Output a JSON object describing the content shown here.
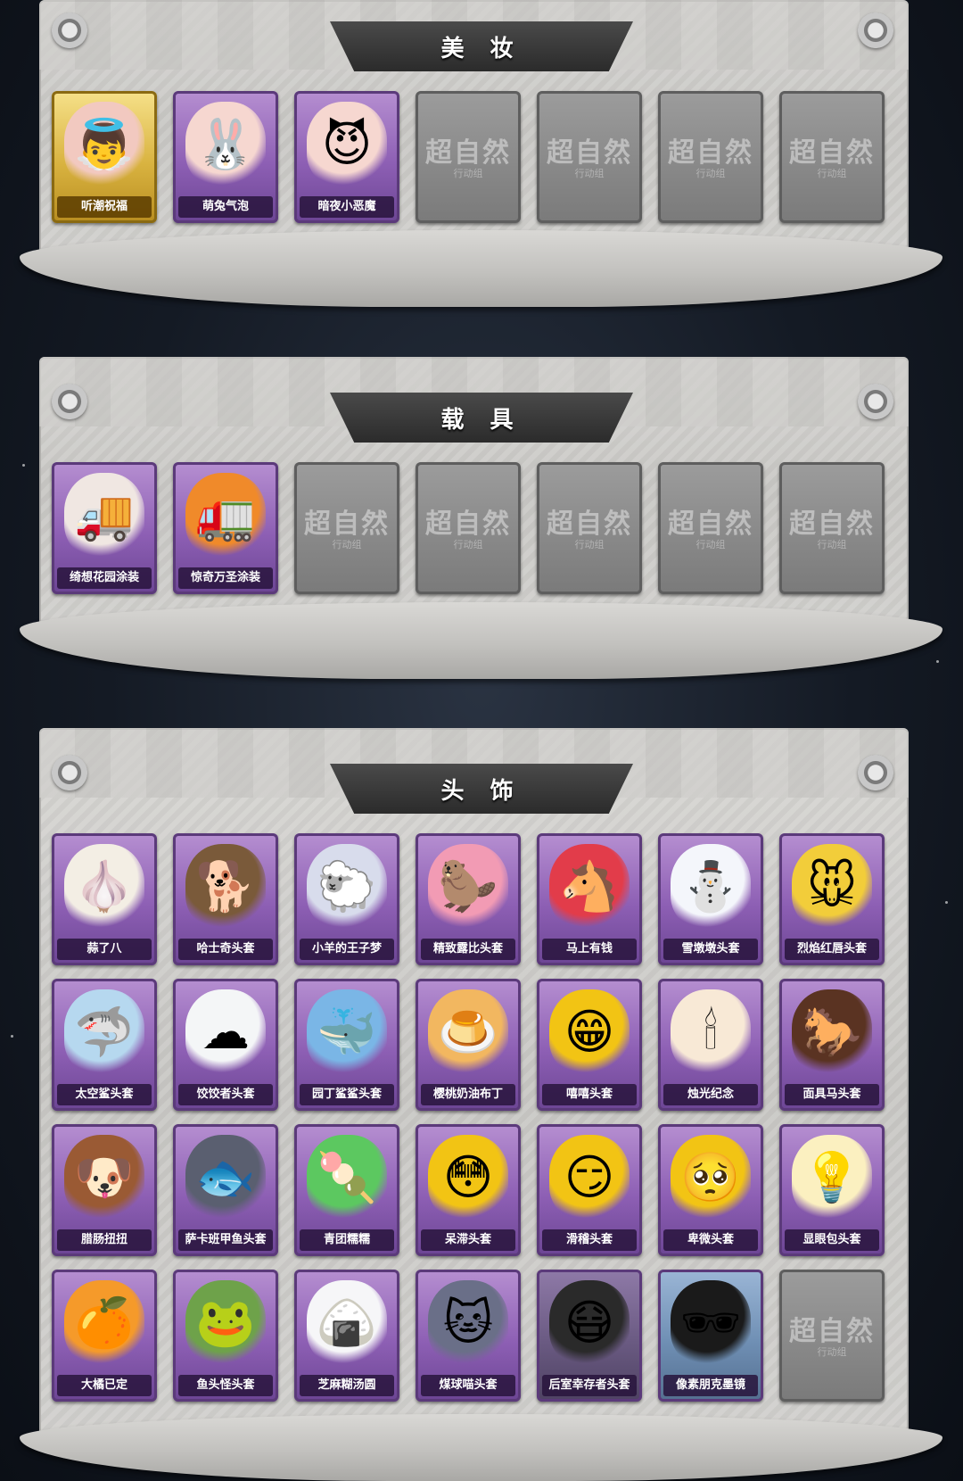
{
  "sections": [
    {
      "title": "美 妆",
      "cards": [
        {
          "label": "听潮祝福",
          "rarity": "gold",
          "icon": "face-with-wings-icon",
          "glyph": "👼",
          "color": "#f2c9c0"
        },
        {
          "label": "萌兔气泡",
          "rarity": "purple",
          "icon": "bunny-face-icon",
          "glyph": "🐰",
          "color": "#f6d7d0"
        },
        {
          "label": "暗夜小恶魔",
          "rarity": "purple",
          "icon": "devil-face-icon",
          "glyph": "😈",
          "color": "#f6d7d0"
        },
        {
          "label": "",
          "rarity": "empty",
          "watermark": "超自然",
          "sub": "行动组"
        },
        {
          "label": "",
          "rarity": "empty",
          "watermark": "超自然",
          "sub": "行动组"
        },
        {
          "label": "",
          "rarity": "empty",
          "watermark": "超自然",
          "sub": "行动组"
        },
        {
          "label": "",
          "rarity": "empty",
          "watermark": "超自然",
          "sub": "行动组"
        }
      ]
    },
    {
      "title": "载 具",
      "cards": [
        {
          "label": "绮想花园涂装",
          "rarity": "purple",
          "icon": "food-truck-icon",
          "glyph": "🚚",
          "color": "#f0e7e2"
        },
        {
          "label": "惊奇万圣涂装",
          "rarity": "purple",
          "icon": "halloween-truck-icon",
          "glyph": "🚛",
          "color": "#f08a2a"
        },
        {
          "label": "",
          "rarity": "empty",
          "watermark": "超自然",
          "sub": "行动组"
        },
        {
          "label": "",
          "rarity": "empty",
          "watermark": "超自然",
          "sub": "行动组"
        },
        {
          "label": "",
          "rarity": "empty",
          "watermark": "超自然",
          "sub": "行动组"
        },
        {
          "label": "",
          "rarity": "empty",
          "watermark": "超自然",
          "sub": "行动组"
        },
        {
          "label": "",
          "rarity": "empty",
          "watermark": "超自然",
          "sub": "行动组"
        }
      ]
    },
    {
      "title": "头 饰",
      "cards": [
        {
          "label": "蒜了八",
          "rarity": "purple",
          "icon": "garlic-icon",
          "glyph": "🧄",
          "color": "#f3eee4"
        },
        {
          "label": "哈士奇头套",
          "rarity": "purple",
          "icon": "dog-sunglasses-icon",
          "glyph": "🐕",
          "color": "#7a5a3a"
        },
        {
          "label": "小羊的王子梦",
          "rarity": "purple",
          "icon": "sheep-crown-icon",
          "glyph": "🐑",
          "color": "#d8dcec"
        },
        {
          "label": "精致露比头套",
          "rarity": "purple",
          "icon": "pink-beaver-icon",
          "glyph": "🦫",
          "color": "#f29bb4"
        },
        {
          "label": "马上有钱",
          "rarity": "purple",
          "icon": "red-horse-icon",
          "glyph": "🐴",
          "color": "#e23c4a"
        },
        {
          "label": "雪墩墩头套",
          "rarity": "purple",
          "icon": "snowman-icon",
          "glyph": "⛄",
          "color": "#f4f6fb"
        },
        {
          "label": "烈焰红唇头套",
          "rarity": "purple",
          "icon": "pikachu-lips-icon",
          "glyph": "🐭",
          "color": "#f2cd3a"
        },
        {
          "label": "太空鲨头套",
          "rarity": "purple",
          "icon": "shark-helmet-icon",
          "glyph": "🦈",
          "color": "#b6d8ef"
        },
        {
          "label": "饺饺者头套",
          "rarity": "purple",
          "icon": "dumpling-cloud-icon",
          "glyph": "☁",
          "color": "#f4f6f7"
        },
        {
          "label": "园丁鲨鲨头套",
          "rarity": "purple",
          "icon": "bee-shark-icon",
          "glyph": "🐳",
          "color": "#7ab6e6"
        },
        {
          "label": "樱桃奶油布丁",
          "rarity": "purple",
          "icon": "pudding-icon",
          "glyph": "🍮",
          "color": "#f2b760"
        },
        {
          "label": "嘻嘻头套",
          "rarity": "purple",
          "icon": "grin-emoji-icon",
          "glyph": "😁",
          "color": "#f2c414"
        },
        {
          "label": "烛光纪念",
          "rarity": "purple",
          "icon": "candle-icon",
          "glyph": "🕯",
          "color": "#f8e9d6"
        },
        {
          "label": "面具马头套",
          "rarity": "purple",
          "icon": "horse-mask-icon",
          "glyph": "🐎",
          "color": "#5a3322"
        },
        {
          "label": "腊肠扭扭",
          "rarity": "purple",
          "icon": "dachshund-icon",
          "glyph": "🐶",
          "color": "#9a5a34"
        },
        {
          "label": "萨卡班甲鱼头套",
          "rarity": "purple",
          "icon": "fish-head-icon",
          "glyph": "🐟",
          "color": "#5a5f70"
        },
        {
          "label": "青团糯糯",
          "rarity": "purple",
          "icon": "green-rice-ball-icon",
          "glyph": "🍡",
          "color": "#5cc860"
        },
        {
          "label": "呆滞头套",
          "rarity": "purple",
          "icon": "dazed-emoji-icon",
          "glyph": "😳",
          "color": "#f2c414"
        },
        {
          "label": "滑稽头套",
          "rarity": "purple",
          "icon": "funny-emoji-icon",
          "glyph": "😏",
          "color": "#f2c414"
        },
        {
          "label": "卑微头套",
          "rarity": "purple",
          "icon": "humble-emoji-icon",
          "glyph": "🥺",
          "color": "#f2c414"
        },
        {
          "label": "显眼包头套",
          "rarity": "purple",
          "icon": "lightbulb-crown-icon",
          "glyph": "💡",
          "color": "#fbf0c0"
        },
        {
          "label": "大橘已定",
          "rarity": "purple",
          "icon": "orange-slice-icon",
          "glyph": "🍊",
          "color": "#f59a2a"
        },
        {
          "label": "鱼头怪头套",
          "rarity": "purple",
          "icon": "fish-man-icon",
          "glyph": "🐸",
          "color": "#6ea24a"
        },
        {
          "label": "芝麻糊汤圆",
          "rarity": "purple",
          "icon": "rice-dumpling-icon",
          "glyph": "🍙",
          "color": "#f6f6f8"
        },
        {
          "label": "煤球喵头套",
          "rarity": "purple",
          "icon": "gray-cat-icon",
          "glyph": "🐱",
          "color": "#6a6f88"
        },
        {
          "label": "后室幸存者头套",
          "rarity": "purple-dark",
          "icon": "gas-mask-icon",
          "glyph": "😷",
          "color": "#2a2a2a"
        },
        {
          "label": "像素朋克墨镜",
          "rarity": "blue",
          "icon": "pixel-sunglasses-icon",
          "glyph": "🕶",
          "color": "#1a1a1a"
        },
        {
          "label": "",
          "rarity": "empty",
          "watermark": "超自然",
          "sub": "行动组"
        }
      ]
    }
  ]
}
